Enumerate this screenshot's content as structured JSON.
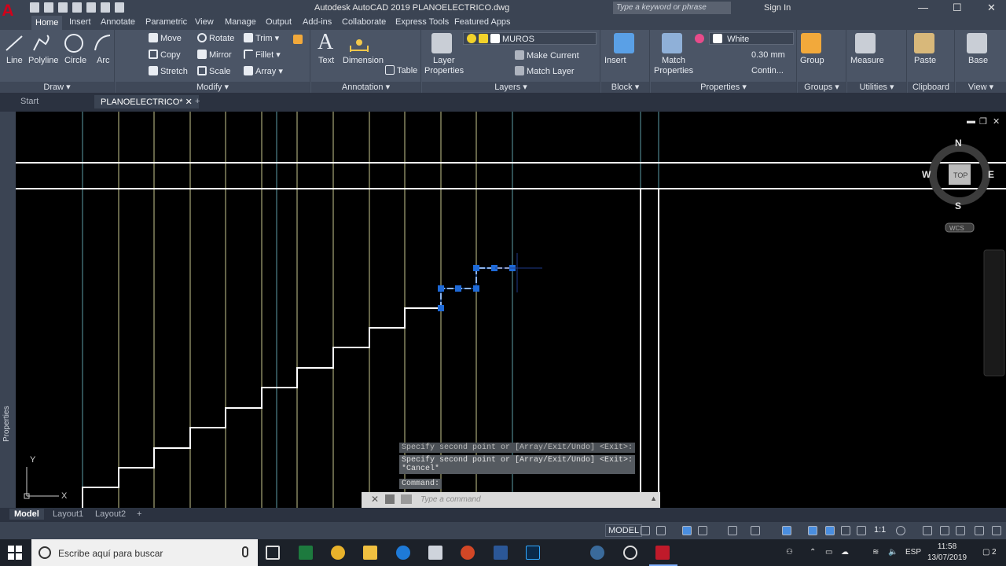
{
  "window": {
    "app_logo": "A",
    "title": "Autodesk AutoCAD 2019    PLANOELECTRICO.dwg",
    "search_placeholder": "Type a keyword or phrase",
    "signin": "Sign In",
    "minimize": "—",
    "maximize": "☐",
    "close": "✕"
  },
  "ribbon_tabs": [
    "Home",
    "Insert",
    "Annotate",
    "Parametric",
    "View",
    "Manage",
    "Output",
    "Add-ins",
    "Collaborate",
    "Express Tools",
    "Featured Apps"
  ],
  "ribbon": {
    "draw": {
      "title": "Draw",
      "line": "Line",
      "polyline": "Polyline",
      "circle": "Circle",
      "arc": "Arc"
    },
    "modify": {
      "title": "Modify",
      "move": "Move",
      "rotate": "Rotate",
      "trim": "Trim",
      "copy": "Copy",
      "mirror": "Mirror",
      "fillet": "Fillet",
      "stretch": "Stretch",
      "scale": "Scale",
      "array": "Array"
    },
    "annotation": {
      "title": "Annotation",
      "text": "Text",
      "dimension": "Dimension",
      "table": "Table"
    },
    "layers": {
      "title": "Layers",
      "layer_properties_1": "Layer",
      "layer_properties_2": "Properties",
      "current_layer": "MUROS",
      "make_current": "Make Current",
      "match_layer": "Match Layer"
    },
    "block": {
      "title": "Block",
      "insert": "Insert"
    },
    "properties": {
      "title": "Properties",
      "match_1": "Match",
      "match_2": "Properties",
      "color": "White",
      "lineweight": "0.30 mm",
      "linetype": "Contin..."
    },
    "groups": {
      "title": "Groups",
      "group": "Group"
    },
    "utilities": {
      "title": "Utilities",
      "measure": "Measure"
    },
    "clipboard": {
      "title": "Clipboard",
      "paste": "Paste"
    },
    "view": {
      "title": "View",
      "base": "Base"
    }
  },
  "doc_tabs": {
    "start": "Start",
    "file": "PLANOELECTRICO*",
    "new": "+"
  },
  "side_palette": "Properties",
  "viewcube": {
    "n": "N",
    "s": "S",
    "e": "E",
    "w": "W",
    "top": "TOP",
    "wcs": "WCS"
  },
  "ucs": {
    "y": "Y",
    "x": "X"
  },
  "command_line": {
    "history": [
      "Specify second point or [Array/Exit/Undo] <Exit>:",
      "Specify second point or [Array/Exit/Undo] <Exit>:\n*Cancel*",
      "Command:"
    ],
    "placeholder": "Type a command"
  },
  "layout_tabs": [
    "Model",
    "Layout1",
    "Layout2",
    "+"
  ],
  "status": {
    "model": "MODEL",
    "scale": "1:1"
  },
  "taskbar": {
    "search_text": "Escribe aquí para buscar",
    "language": "ESP",
    "time": "11:58",
    "date": "13/07/2019",
    "notifications": "2"
  },
  "colors": {
    "canvas": "#000000",
    "grip": "#1e6ad8",
    "ribbon": "#4b5566",
    "titlebar": "#3b4453",
    "accent_red": "#d0021b"
  }
}
